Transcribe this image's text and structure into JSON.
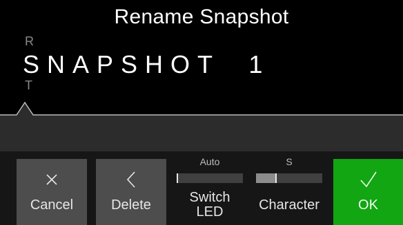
{
  "screen": {
    "title": "Rename Snapshot",
    "editor": {
      "char_above": "R",
      "name_value": "SNAPSHOT  1",
      "char_below": "T"
    }
  },
  "bottom_bar": {
    "cancel": {
      "label": "Cancel",
      "icon": "close-icon"
    },
    "delete": {
      "label": "Delete",
      "icon": "chevron-left-icon"
    },
    "switch_led": {
      "value": "Auto",
      "name_line1": "Switch",
      "name_line2": "LED",
      "level": 0.0
    },
    "character": {
      "value": "S",
      "name": "Character",
      "level": 0.3
    },
    "ok": {
      "label": "OK",
      "icon": "checkmark-icon"
    }
  },
  "colors": {
    "background": "#000000",
    "button_gray": "#4d4d4d",
    "ok_green": "#12a612",
    "strip_gray": "#2c2c2c"
  }
}
